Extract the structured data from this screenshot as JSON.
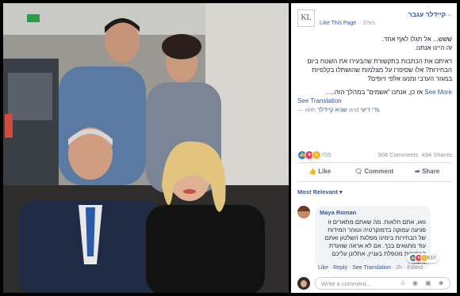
{
  "post": {
    "page_name": "קיידלר עגבר",
    "logo_text": "KL",
    "like_page": "Like This Page",
    "time": "· 3 hrs ·",
    "options": "···",
    "paragraph1_line1": "ששש... אל תגלו לאף אחד.",
    "paragraph1_line2": "זה היינו אנחנו.",
    "paragraph2": "ראיתם את הכתבות בתקשורת שהבעירו את השטח ביום הבחירות? אלו שסיפרו על מצלמות שהושתלו בקלפיות במגזר הערבי ומנעו אלפי זיופים?",
    "paragraph3": "אז כן, אנחנו \"אשמים\" במהלך הזה.....",
    "see_more": "See More",
    "see_translation": "See Translation",
    "with_prefix": "— with",
    "tagged_1": "שגיא קיידלר",
    "tagged_and": "and",
    "tagged_2": "גדי דיעי",
    "tagged_suffix": "."
  },
  "stats": {
    "reactions": "705",
    "comments": "908 Comments",
    "shares": "494 Shares"
  },
  "actions": {
    "like": "Like",
    "comment": "Comment",
    "share": "Share"
  },
  "comments": {
    "sort": "Most Relevant ▾",
    "first": {
      "author": "Maya Roman",
      "text": "וואו, אתם חלאות. מה שאתם מתארים זו פגיעה עמוקה בדמוקרטיה וטוהר המידות של הבחירות בימינו מפלגת השלטון ואתם עוד מתגאים בכך. אם לא אראה שוועדת הבחירות מטפלת בעניין, אתלונן עליכם בעצמי.",
      "reaction_count": "610",
      "like": "Like",
      "reply": "Reply",
      "see_translation": "See Translation",
      "age": "2h",
      "edited": "Edited"
    },
    "write_placeholder": "Write a comment..."
  },
  "colors": {
    "link": "#385898",
    "muted": "#90949c",
    "like_blue": "#1877f2",
    "love_red": "#f33e58",
    "haha_yellow": "#f7b125"
  },
  "icons": [
    "like-icon",
    "love-icon",
    "haha-icon",
    "thumb-icon",
    "comment-icon",
    "share-icon",
    "emoji-icon",
    "camera-icon",
    "gif-icon",
    "sticker-icon"
  ]
}
